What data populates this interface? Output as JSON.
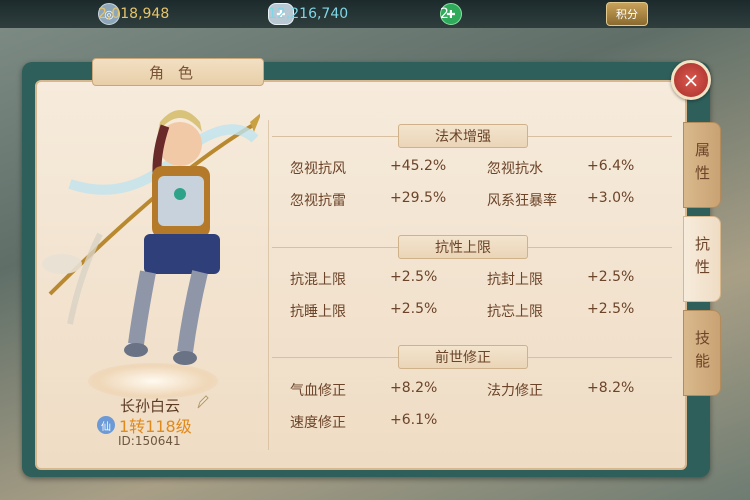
{
  "currencies": {
    "silver": "2,018,948",
    "gold": "12,216,740",
    "gem": "2",
    "jifen_label": "积分"
  },
  "panel": {
    "title": "角色",
    "close_label": "×"
  },
  "character": {
    "name": "长孙白云",
    "badge": "仙",
    "level": "1转118级",
    "id": "ID:150641"
  },
  "sections": {
    "magic": {
      "title": "法术增强",
      "rows": [
        {
          "l1": "忽视抗风",
          "v1": "+45.2%",
          "l2": "忽视抗水",
          "v2": "+6.4%"
        },
        {
          "l1": "忽视抗雷",
          "v1": "+29.5%",
          "l2": "风系狂暴率",
          "v2": "+3.0%"
        }
      ]
    },
    "resist": {
      "title": "抗性上限",
      "rows": [
        {
          "l1": "抗混上限",
          "v1": "+2.5%",
          "l2": "抗封上限",
          "v2": "+2.5%"
        },
        {
          "l1": "抗睡上限",
          "v1": "+2.5%",
          "l2": "抗忘上限",
          "v2": "+2.5%"
        }
      ]
    },
    "past": {
      "title": "前世修正",
      "rows": [
        {
          "l1": "气血修正",
          "v1": "+8.2%",
          "l2": "法力修正",
          "v2": "+8.2%"
        },
        {
          "l1": "速度修正",
          "v1": "+6.1%"
        }
      ]
    }
  },
  "tabs": {
    "attributes": "属性",
    "resistance": "抗性",
    "skills": "技能"
  },
  "colors": {
    "accent": "#e08a1c",
    "text": "#6b4429",
    "close": "#c0392b"
  }
}
